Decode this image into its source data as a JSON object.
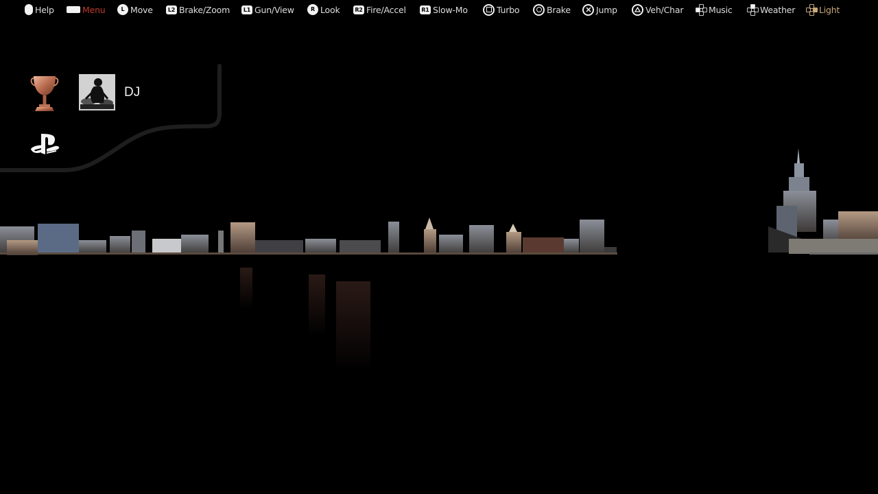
{
  "controls": [
    {
      "icon": "touchpad-icon",
      "label": "Help",
      "highlight": false
    },
    {
      "icon": "options-button-icon",
      "label": "Menu",
      "highlight": true
    },
    {
      "icon": "left-stick-icon",
      "icon_text": "L",
      "label": "Move",
      "highlight": false
    },
    {
      "icon": "l2-button-icon",
      "icon_text": "L2",
      "label": "Brake/Zoom",
      "highlight": false
    },
    {
      "icon": "l1-button-icon",
      "icon_text": "L1",
      "label": "Gun/View",
      "highlight": false
    },
    {
      "icon": "right-stick-icon",
      "icon_text": "R",
      "label": "Look",
      "highlight": false
    },
    {
      "icon": "r2-button-icon",
      "icon_text": "R2",
      "label": "Fire/Accel",
      "highlight": false
    },
    {
      "icon": "r1-button-icon",
      "icon_text": "R1",
      "label": "Slow-Mo",
      "highlight": false
    },
    {
      "icon": "square-button-icon",
      "label": "Turbo",
      "highlight": false
    },
    {
      "icon": "circle-button-icon",
      "label": "Brake",
      "highlight": false
    },
    {
      "icon": "cross-button-icon",
      "label": "Jump",
      "highlight": false
    },
    {
      "icon": "triangle-button-icon",
      "label": "Veh/Char",
      "highlight": false
    },
    {
      "icon": "dpad-left-icon",
      "label": "Music",
      "highlight": false
    },
    {
      "icon": "dpad-up-icon",
      "label": "Weather",
      "highlight": false
    },
    {
      "icon": "dpad-right-icon",
      "label": "Light",
      "highlight": false
    }
  ],
  "colors": {
    "menu_highlight": "#c0392b",
    "light_label": "#c9a87a",
    "text": "#dddddd",
    "background": "#000000"
  },
  "profile": {
    "username": "DJ",
    "trophy_icon": "bronze-trophy-icon",
    "avatar_icon": "dj-avatar-icon",
    "platform_icon": "playstation-logo-icon"
  }
}
